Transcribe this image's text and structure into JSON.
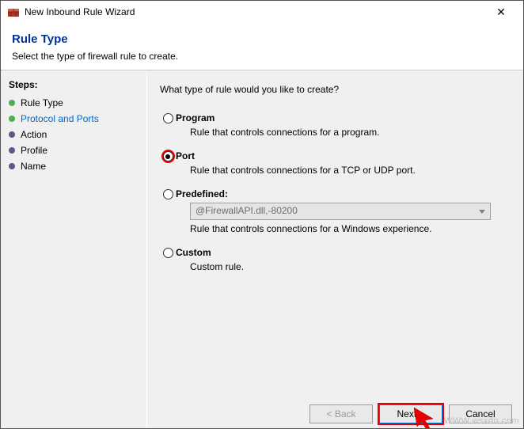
{
  "window": {
    "title": "New Inbound Rule Wizard",
    "close_label": "✕"
  },
  "header": {
    "title": "Rule Type",
    "subtitle": "Select the type of firewall rule to create."
  },
  "steps": {
    "heading": "Steps:",
    "items": [
      {
        "label": "Rule Type",
        "state": "done"
      },
      {
        "label": "Protocol and Ports",
        "state": "current"
      },
      {
        "label": "Action",
        "state": "future"
      },
      {
        "label": "Profile",
        "state": "future"
      },
      {
        "label": "Name",
        "state": "future"
      }
    ]
  },
  "content": {
    "prompt": "What type of rule would you like to create?",
    "options": {
      "program": {
        "label": "Program",
        "desc": "Rule that controls connections for a program."
      },
      "port": {
        "label": "Port",
        "desc": "Rule that controls connections for a TCP or UDP port."
      },
      "predefined": {
        "label": "Predefined:",
        "value": "@FirewallAPI.dll,-80200",
        "desc": "Rule that controls connections for a Windows experience."
      },
      "custom": {
        "label": "Custom",
        "desc": "Custom rule."
      }
    },
    "selected": "port"
  },
  "buttons": {
    "back": "< Back",
    "next": "Next >",
    "cancel": "Cancel"
  },
  "watermark": "WWW.wsxdn.com"
}
